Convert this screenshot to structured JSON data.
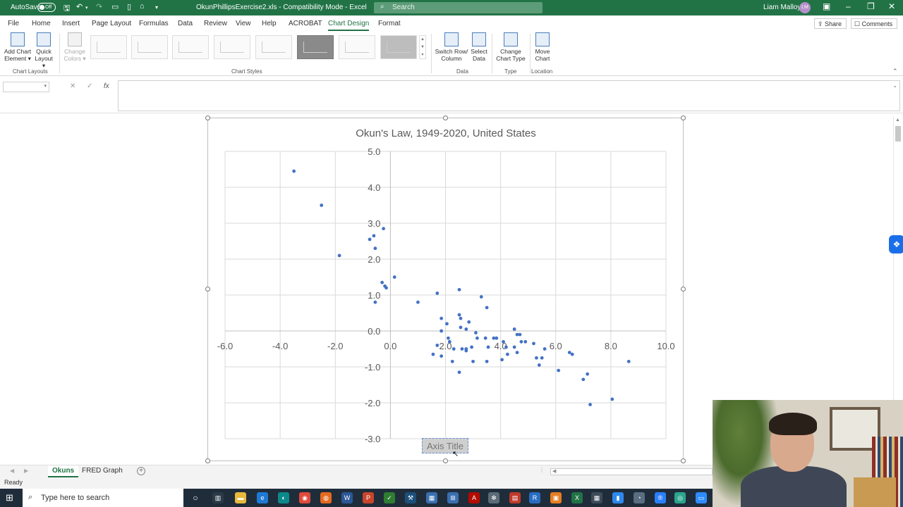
{
  "titlebar": {
    "autosave_label": "AutoSave",
    "autosave_state": "Off",
    "filename": "OkunPhillipsExercise2.xls  -  Compatibility Mode  -  Excel",
    "search_placeholder": "Search",
    "user_name": "Liam Malloy",
    "user_initials": "LM"
  },
  "tabs": [
    "File",
    "Home",
    "Insert",
    "Page Layout",
    "Formulas",
    "Data",
    "Review",
    "View",
    "Help",
    "ACROBAT",
    "Chart Design",
    "Format"
  ],
  "active_tab": "Chart Design",
  "actions": {
    "share": "Share",
    "comments": "Comments"
  },
  "ribbon": {
    "add_chart_element": [
      "Add Chart",
      "Element ▾"
    ],
    "quick_layout": [
      "Quick",
      "Layout ▾"
    ],
    "change_colors": [
      "Change",
      "Colors ▾"
    ],
    "group_chart_layouts": "Chart Layouts",
    "group_chart_styles": "Chart Styles",
    "switch_row_col": [
      "Switch Row/",
      "Column"
    ],
    "select_data": [
      "Select",
      "Data"
    ],
    "group_data": "Data",
    "change_chart_type": [
      "Change",
      "Chart Type"
    ],
    "group_type": "Type",
    "move_chart": [
      "Move",
      "Chart"
    ],
    "group_location": "Location"
  },
  "formula_bar": {
    "namebox": "",
    "cancel": "✕",
    "enter": "✓",
    "fx": "fx",
    "value": ""
  },
  "chart": {
    "title": "Okun's Law, 1949-2020, United States",
    "x_axis_title": "Axis Title",
    "series_color": "#4472c4"
  },
  "chart_data": {
    "type": "scatter",
    "title": "Okun's Law, 1949-2020, United States",
    "xlabel": "Axis Title",
    "ylabel": "",
    "xlim": [
      -6.0,
      10.0
    ],
    "ylim": [
      -3.0,
      5.0
    ],
    "x_ticks": [
      "-6.0",
      "-4.0",
      "-2.0",
      "0.0",
      "2.0",
      "4.0",
      "6.0",
      "8.0",
      "10.0"
    ],
    "y_ticks": [
      "5.0",
      "4.0",
      "3.0",
      "2.0",
      "1.0",
      "0.0",
      "-1.0",
      "-2.0",
      "-3.0"
    ],
    "grid": true,
    "points": [
      [
        -3.5,
        4.45
      ],
      [
        -2.5,
        3.5
      ],
      [
        -1.85,
        2.1
      ],
      [
        -0.75,
        2.55
      ],
      [
        -0.6,
        2.65
      ],
      [
        -0.55,
        2.3
      ],
      [
        -0.25,
        2.85
      ],
      [
        -0.3,
        1.35
      ],
      [
        -0.15,
        1.2
      ],
      [
        -0.2,
        1.25
      ],
      [
        0.15,
        1.5
      ],
      [
        -0.55,
        0.8
      ],
      [
        1.0,
        0.8
      ],
      [
        1.7,
        1.05
      ],
      [
        2.5,
        1.15
      ],
      [
        3.3,
        0.95
      ],
      [
        3.5,
        0.65
      ],
      [
        1.85,
        0.35
      ],
      [
        2.5,
        0.45
      ],
      [
        2.55,
        0.35
      ],
      [
        2.05,
        0.2
      ],
      [
        2.85,
        0.25
      ],
      [
        2.55,
        0.1
      ],
      [
        2.75,
        0.05
      ],
      [
        1.85,
        0.0
      ],
      [
        3.1,
        -0.05
      ],
      [
        4.5,
        0.05
      ],
      [
        4.7,
        -0.1
      ],
      [
        4.6,
        -0.1
      ],
      [
        2.1,
        -0.2
      ],
      [
        2.15,
        -0.3
      ],
      [
        3.15,
        -0.2
      ],
      [
        3.45,
        -0.2
      ],
      [
        3.75,
        -0.2
      ],
      [
        3.85,
        -0.2
      ],
      [
        4.1,
        -0.3
      ],
      [
        4.75,
        -0.3
      ],
      [
        4.9,
        -0.3
      ],
      [
        5.2,
        -0.35
      ],
      [
        1.7,
        -0.4
      ],
      [
        2.3,
        -0.5
      ],
      [
        2.6,
        -0.5
      ],
      [
        2.75,
        -0.5
      ],
      [
        2.95,
        -0.45
      ],
      [
        3.55,
        -0.45
      ],
      [
        4.2,
        -0.45
      ],
      [
        4.5,
        -0.45
      ],
      [
        5.6,
        -0.5
      ],
      [
        1.55,
        -0.65
      ],
      [
        1.85,
        -0.7
      ],
      [
        2.75,
        -0.55
      ],
      [
        4.6,
        -0.6
      ],
      [
        4.25,
        -0.65
      ],
      [
        6.5,
        -0.6
      ],
      [
        6.6,
        -0.65
      ],
      [
        2.25,
        -0.85
      ],
      [
        3.0,
        -0.85
      ],
      [
        3.5,
        -0.85
      ],
      [
        4.05,
        -0.8
      ],
      [
        5.3,
        -0.75
      ],
      [
        5.5,
        -0.75
      ],
      [
        5.4,
        -0.95
      ],
      [
        6.1,
        -1.1
      ],
      [
        2.5,
        -1.15
      ],
      [
        7.0,
        -1.35
      ],
      [
        7.15,
        -1.2
      ],
      [
        7.25,
        -2.05
      ],
      [
        8.05,
        -1.9
      ],
      [
        8.65,
        -0.85
      ]
    ]
  },
  "sheet_tabs": [
    "Okuns",
    "FRED Graph"
  ],
  "active_sheet": "Okuns",
  "status": "Ready",
  "taskbar": {
    "search_placeholder": "Type here to search"
  }
}
